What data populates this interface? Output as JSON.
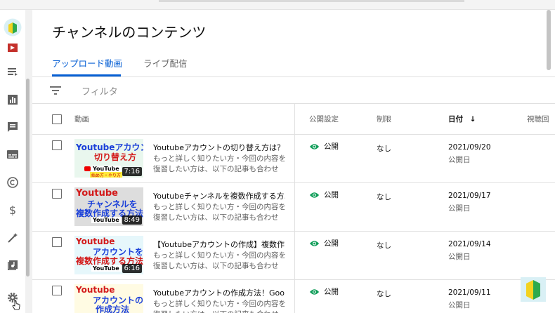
{
  "page": {
    "title": "チャンネルのコンテンツ"
  },
  "tabs": [
    {
      "label": "アップロード動画",
      "active": true
    },
    {
      "label": "ライブ配信",
      "active": false
    }
  ],
  "filter": {
    "placeholder": "フィルタ"
  },
  "table": {
    "headers": {
      "video": "動画",
      "visibility": "公開設定",
      "restrictions": "制限",
      "date": "日付",
      "views": "視聴回"
    },
    "rows": [
      {
        "thumb_line1": "Youtubeアカウントの",
        "thumb_line2": "切り替え方",
        "thumb_line3": "",
        "thumb_bg": "#e9f7ee",
        "duration": "7:16",
        "title": "Youtubeアカウントの切り替え方は？...",
        "desc": "もっと詳しく知りたい方・今回の内容を復習したい方は、以下の記事も合わせて...",
        "visibility": "公開",
        "restriction": "なし",
        "date": "2021/09/20",
        "date_type": "公開日"
      },
      {
        "thumb_line1": "Youtube",
        "thumb_line2": "チャンネルを",
        "thumb_line3": "複数作成する方法",
        "thumb_bg": "#dddddd",
        "duration": "8:49",
        "title": "Youtubeチャンネルを複数作成する方...",
        "desc": "もっと詳しく知りたい方・今回の内容を復習したい方は、以下の記事も合わせて...",
        "visibility": "公開",
        "restriction": "なし",
        "date": "2021/09/17",
        "date_type": "公開日"
      },
      {
        "thumb_line1": "Youtube",
        "thumb_line2": "アカウントを",
        "thumb_line3": "複数作成する方法",
        "thumb_bg": "#e6f7fb",
        "duration": "6:16",
        "title": "【Youtubeアカウントの作成】複数作...",
        "desc": "もっと詳しく知りたい方・今回の内容を復習したい方は、以下の記事も合わせて...",
        "visibility": "公開",
        "restriction": "なし",
        "date": "2021/09/14",
        "date_type": "公開日"
      },
      {
        "thumb_line1": "Youtube",
        "thumb_line2": "アカウントの",
        "thumb_line3": "作成方法",
        "thumb_bg": "#fffbe3",
        "duration": "",
        "title": "Youtubeアカウントの作成方法！Goo...",
        "desc": "もっと詳しく知りたい方・今回の内容を復習したい方は、以下の記事も合わせて...",
        "visibility": "公開",
        "restriction": "なし",
        "date": "2021/09/11",
        "date_type": "公開日"
      }
    ]
  },
  "thumb_badge": {
    "channel": "YouTube",
    "subtitle": "始め方・やり方"
  },
  "sidebar_icons": [
    "beginner-mark-icon",
    "content-icon",
    "playlist-icon",
    "analytics-icon",
    "comments-icon",
    "subtitles-icon",
    "copyright-icon",
    "monetization-icon",
    "customization-icon",
    "audio-library-icon",
    "settings-icon"
  ],
  "colors": {
    "accent": "#065fd4",
    "visibility_icon": "#0f9d58"
  }
}
